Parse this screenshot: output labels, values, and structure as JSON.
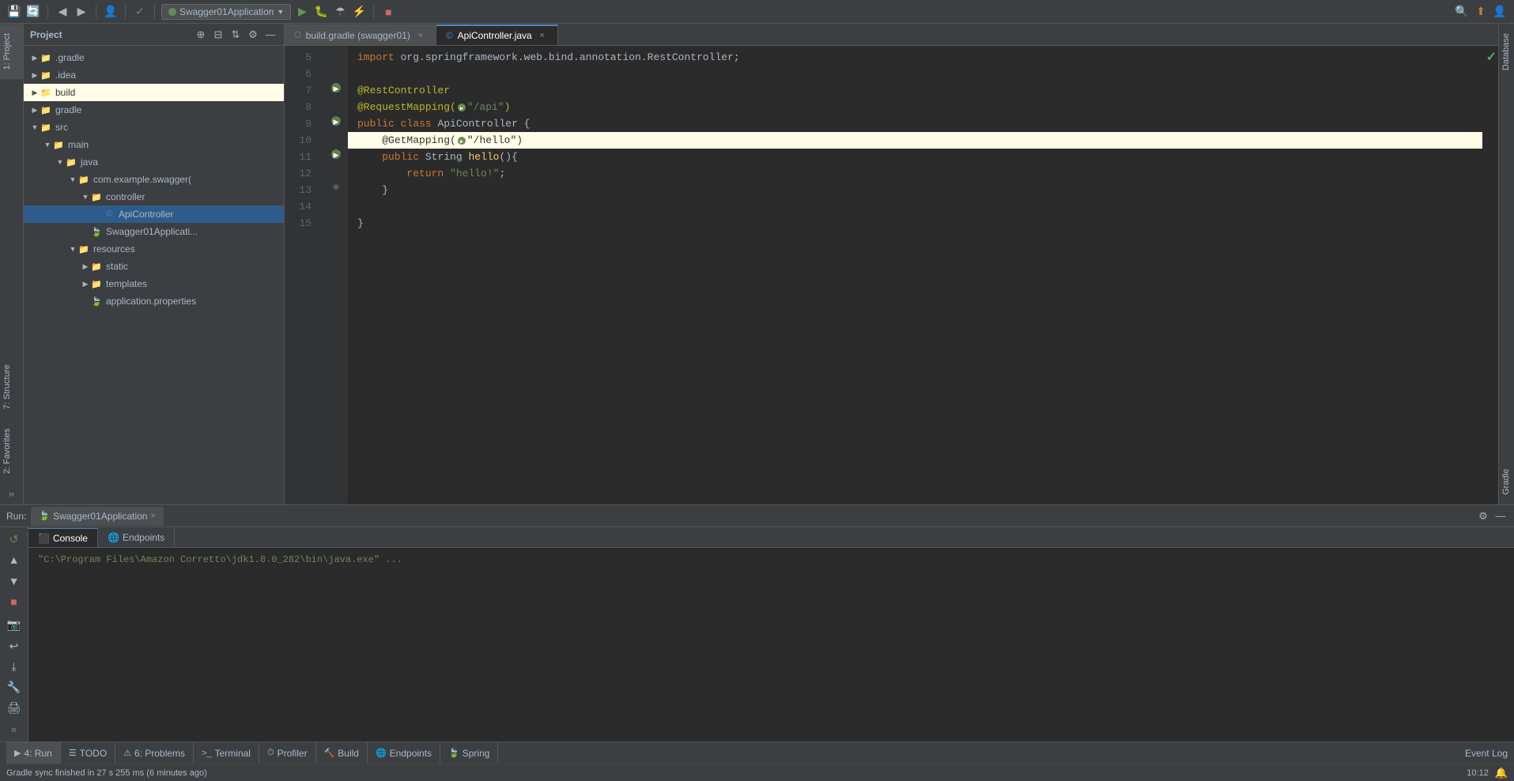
{
  "toolbar": {
    "run_config": "Swagger01Application",
    "icons": [
      "save",
      "sync",
      "back",
      "forward",
      "user",
      "git",
      "run_app",
      "refresh",
      "debug",
      "coverage",
      "run_stop"
    ],
    "search_icon": "🔍",
    "update_icon": "⬆",
    "profile_icon": "👤"
  },
  "project": {
    "title": "Project",
    "items": [
      {
        "indent": 0,
        "label": ".gradle",
        "type": "folder",
        "expanded": false
      },
      {
        "indent": 0,
        "label": ".idea",
        "type": "folder",
        "expanded": false
      },
      {
        "indent": 0,
        "label": "build",
        "type": "folder",
        "expanded": false,
        "highlighted": true
      },
      {
        "indent": 0,
        "label": "gradle",
        "type": "folder",
        "expanded": false
      },
      {
        "indent": 0,
        "label": "src",
        "type": "folder",
        "expanded": true
      },
      {
        "indent": 1,
        "label": "main",
        "type": "folder",
        "expanded": true
      },
      {
        "indent": 2,
        "label": "java",
        "type": "folder",
        "expanded": true
      },
      {
        "indent": 3,
        "label": "com.example.swagger(",
        "type": "folder",
        "expanded": true
      },
      {
        "indent": 4,
        "label": "controller",
        "type": "folder",
        "expanded": true
      },
      {
        "indent": 5,
        "label": "ApiController",
        "type": "java",
        "expanded": false
      },
      {
        "indent": 4,
        "label": "Swagger01Applicati...",
        "type": "spring",
        "expanded": false
      },
      {
        "indent": 3,
        "label": "resources",
        "type": "folder",
        "expanded": true
      },
      {
        "indent": 4,
        "label": "static",
        "type": "folder",
        "expanded": false
      },
      {
        "indent": 4,
        "label": "templates",
        "type": "folder",
        "expanded": false
      },
      {
        "indent": 4,
        "label": "application.properties",
        "type": "props",
        "expanded": false
      }
    ]
  },
  "editor": {
    "tabs": [
      {
        "id": "build-gradle",
        "label": "build.gradle (swagger01)",
        "type": "gradle",
        "active": false
      },
      {
        "id": "api-controller",
        "label": "ApiController.java",
        "type": "java",
        "active": true
      }
    ],
    "code_lines": [
      {
        "num": 5,
        "content": "import org.springframework.web.bind.annotation.RestController;",
        "type": "import"
      },
      {
        "num": 6,
        "content": "",
        "type": "blank"
      },
      {
        "num": 7,
        "content": "@RestController",
        "type": "annotation"
      },
      {
        "num": 8,
        "content": "@RequestMapping(\"/api\")",
        "type": "annotation_mapping"
      },
      {
        "num": 9,
        "content": "public class ApiController {",
        "type": "class_decl"
      },
      {
        "num": 10,
        "content": "    @GetMapping(\"/hello\")",
        "type": "annotation_get",
        "highlighted": true
      },
      {
        "num": 11,
        "content": "    public String hello(){",
        "type": "method_decl"
      },
      {
        "num": 12,
        "content": "        return \"hello!\";",
        "type": "return_stmt"
      },
      {
        "num": 13,
        "content": "    }",
        "type": "close_brace"
      },
      {
        "num": 14,
        "content": "",
        "type": "blank"
      },
      {
        "num": 15,
        "content": "}",
        "type": "close_brace"
      }
    ]
  },
  "run": {
    "label": "Run:",
    "tab_label": "Swagger01Application",
    "console_tabs": [
      "Console",
      "Endpoints"
    ],
    "console_output": "\"C:\\Program Files\\Amazon Corretto\\jdk1.8.0_282\\bin\\java.exe\" ...",
    "active_console_tab": "Console"
  },
  "status_bar": {
    "tabs": [
      {
        "icon": "▶",
        "label": "4: Run"
      },
      {
        "icon": "☰",
        "label": "TODO"
      },
      {
        "icon": "⚠",
        "label": "6: Problems"
      },
      {
        "icon": ">_",
        "label": "Terminal"
      },
      {
        "icon": "⏱",
        "label": "Profiler"
      },
      {
        "icon": "🔨",
        "label": "Build"
      },
      {
        "icon": "🌐",
        "label": "Endpoints"
      },
      {
        "icon": "🍃",
        "label": "Spring"
      }
    ],
    "event_log": "Event Log",
    "gradle_sync_msg": "Gradle sync finished in 27 s 255 ms (6 minutes ago)",
    "time": "10:12",
    "notification": "🔔"
  },
  "right_panels": {
    "database": "Database",
    "gradle": "Gradle"
  },
  "left_panels": {
    "project": "1: Project",
    "structure": "7: Structure",
    "favorites": "2: Favorites"
  }
}
